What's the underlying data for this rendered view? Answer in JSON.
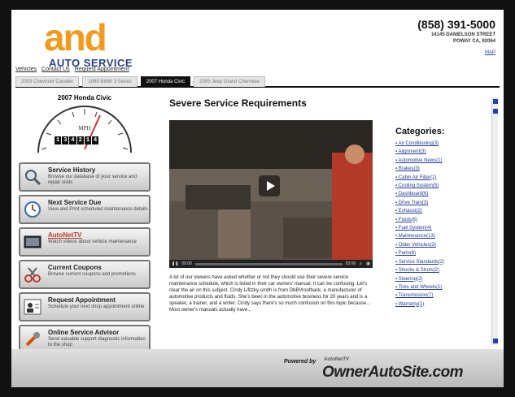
{
  "header": {
    "logo_main": "and",
    "logo_sub": "AUTO SERVICE",
    "phone": "(858) 391-5000",
    "address_line1": "14145 DANIELSON STREET",
    "address_line2": "POWAY CA, 92064",
    "map_link": "MAP"
  },
  "nav": {
    "links": [
      "Vehicles",
      "Contact Us",
      "Request Appointment"
    ]
  },
  "tabs": [
    {
      "label": "2003 Chevrolet Cavalier",
      "active": false
    },
    {
      "label": "1999 BMW 3 Series",
      "active": false
    },
    {
      "label": "2007 Honda Civic",
      "active": true
    },
    {
      "label": "2005 Jeep Grand Cherokee",
      "active": false
    }
  ],
  "sidebar": {
    "vehicle_title": "2007 Honda Civic",
    "gauge_label": "MPH",
    "odometer": [
      "1",
      "3",
      "4",
      "2",
      "1",
      "4"
    ],
    "buttons": [
      {
        "title": "Service History",
        "desc": "Browse our database of your service and repair visits",
        "icon": "magnifier-icon",
        "highlight": false
      },
      {
        "title": "Next Service Due",
        "desc": "View and Print scheduled maintenance details",
        "icon": "clock-icon",
        "highlight": false
      },
      {
        "title": "AutoNetTV",
        "desc": "Watch videos about vehicle maintenance",
        "icon": "tv-icon",
        "highlight": true
      },
      {
        "title": "Current Coupons",
        "desc": "Browse current coupons and promotions",
        "icon": "scissors-icon",
        "highlight": false
      },
      {
        "title": "Request Appointment",
        "desc": "Schedule your next shop appointment online",
        "icon": "person-icon",
        "highlight": false
      },
      {
        "title": "Online Service Advisor",
        "desc": "Send valuable support diagnostic information to the shop",
        "icon": "wrench-icon",
        "highlight": false
      }
    ]
  },
  "main": {
    "title": "Severe Service Requirements",
    "video": {
      "time_current": "00:00",
      "time_total": "03:00",
      "progress": 0.0
    },
    "article": "A lot of our viewers have asked whether or not they should use their severe service maintenance schedule, which is listed in their car owners' manual. It can be confusing. Let's clear the air on this subject. Cindy Lifitzky-smith is from DbBVroofback, a manufacturer of automotive products and fluids. She's been in the automotive business for 20 years and is a speaker, a trainer, and a writer. Cindy says there's so much confusion on this topic because... Most owner's manuals actually have..."
  },
  "categories": {
    "title": "Categories:",
    "items": [
      "Air Conditioning(3)",
      "Alignment(3)",
      "Automotive News(1)",
      "Brakes(3)",
      "Cabin Air Filter(2)",
      "Cooling System(5)",
      "Dashboard(6)",
      "Drive Train(3)",
      "Exhaust(2)",
      "Fluids(6)",
      "Fuel System(4)",
      "Maintenance(13)",
      "Older Vehicles(3)",
      "Parts(8)",
      "Service Standards(2)",
      "Shocks & Struts(2)",
      "Steering(2)",
      "Tires and Wheels(1)",
      "Transmission(7)",
      "Warranty(1)"
    ]
  },
  "footer": {
    "powered_by": "Powered by",
    "brand_small": "AutoNetTV",
    "site": "OwnerAutoSite.com"
  },
  "colors": {
    "logo_orange": "#f39a1c",
    "logo_blue": "#2a3f86",
    "link_blue": "#223a99",
    "active_tab": "#111111"
  }
}
